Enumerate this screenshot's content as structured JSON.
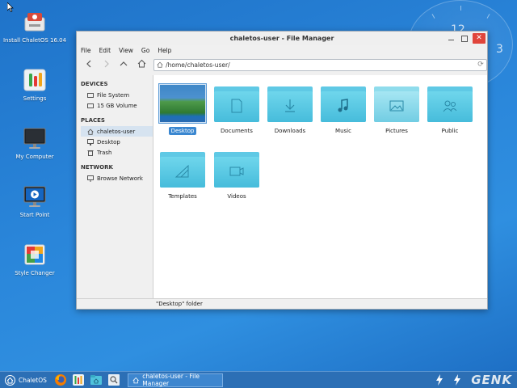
{
  "desktop": {
    "icons": [
      {
        "label": "Install ChaletOS 16.04"
      },
      {
        "label": "Settings"
      },
      {
        "label": "My Computer"
      },
      {
        "label": "Start Point"
      },
      {
        "label": "Style Changer"
      }
    ],
    "clock_numbers": [
      "12",
      "3"
    ]
  },
  "window": {
    "title": "chaletos-user - File Manager",
    "menu": [
      "File",
      "Edit",
      "View",
      "Go",
      "Help"
    ],
    "path": "/home/chaletos-user/",
    "sidebar": {
      "devices_heading": "DEVICES",
      "devices": [
        "File System",
        "15 GB Volume"
      ],
      "places_heading": "PLACES",
      "places": [
        "chaletos-user",
        "Desktop",
        "Trash"
      ],
      "network_heading": "NETWORK",
      "network": [
        "Browse Network"
      ]
    },
    "files": [
      {
        "name": "Desktop",
        "selected": true
      },
      {
        "name": "Documents"
      },
      {
        "name": "Downloads"
      },
      {
        "name": "Music"
      },
      {
        "name": "Pictures"
      },
      {
        "name": "Public"
      },
      {
        "name": "Templates"
      },
      {
        "name": "Videos"
      }
    ],
    "status": "\"Desktop\" folder"
  },
  "taskbar": {
    "start_label": "ChaletOS",
    "task_label": "chaletos-user - File Manager",
    "watermark": "GENK"
  },
  "colors": {
    "desktop_bg": "#2a86da",
    "folder": "#5fc9e5",
    "selection": "#3a87d0",
    "close_button": "#e0453b",
    "taskbar": "#2c6fb5"
  }
}
